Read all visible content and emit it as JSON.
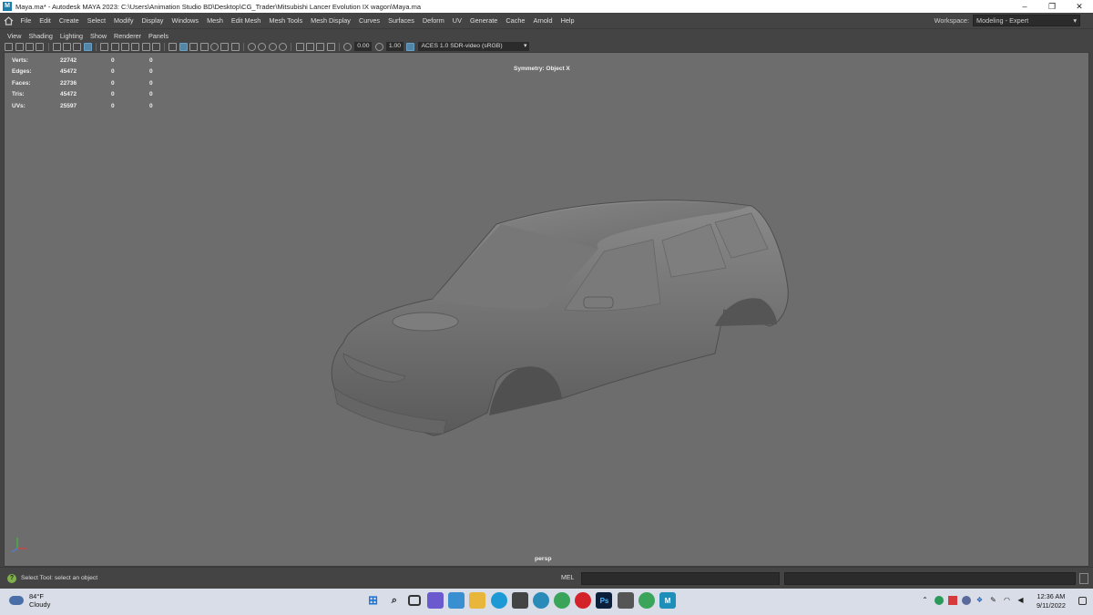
{
  "window": {
    "icon_letter": "M",
    "title": "Maya.ma* - Autodesk MAYA 2023: C:\\Users\\Animation Studio BD\\Desktop\\CG_Trader\\Mitsubishi Lancer Evolution IX wagon\\Maya.ma",
    "minimize": "–",
    "maximize": "❐",
    "close": "✕"
  },
  "main_menu": {
    "items": [
      "File",
      "Edit",
      "Create",
      "Select",
      "Modify",
      "Display",
      "Windows",
      "Mesh",
      "Edit Mesh",
      "Mesh Tools",
      "Mesh Display",
      "Curves",
      "Surfaces",
      "Deform",
      "UV",
      "Generate",
      "Cache",
      "Arnold",
      "Help"
    ],
    "workspace_label": "Workspace:",
    "workspace_value": "Modeling - Expert"
  },
  "panel_menu": {
    "items": [
      "View",
      "Shading",
      "Lighting",
      "Show",
      "Renderer",
      "Panels"
    ]
  },
  "panel_toolbar": {
    "exposure": "0.00",
    "gamma": "1.00",
    "color_space": "ACES 1.0 SDR-video (sRGB)"
  },
  "hud": {
    "rows": [
      {
        "label": "Verts:",
        "v1": "22742",
        "v2": "0",
        "v3": "0"
      },
      {
        "label": "Edges:",
        "v1": "45472",
        "v2": "0",
        "v3": "0"
      },
      {
        "label": "Faces:",
        "v1": "22736",
        "v2": "0",
        "v3": "0"
      },
      {
        "label": "Tris:",
        "v1": "45472",
        "v2": "0",
        "v3": "0"
      },
      {
        "label": "UVs:",
        "v1": "25597",
        "v2": "0",
        "v3": "0"
      }
    ],
    "symmetry": "Symmetry: Object X",
    "camera": "persp"
  },
  "status_line": {
    "help_text": "Select Tool: select an object",
    "mel_label": "MEL"
  },
  "taskbar": {
    "weather_temp": "84°F",
    "weather_desc": "Cloudy",
    "time": "12:36 AM",
    "date": "9/11/2022"
  }
}
